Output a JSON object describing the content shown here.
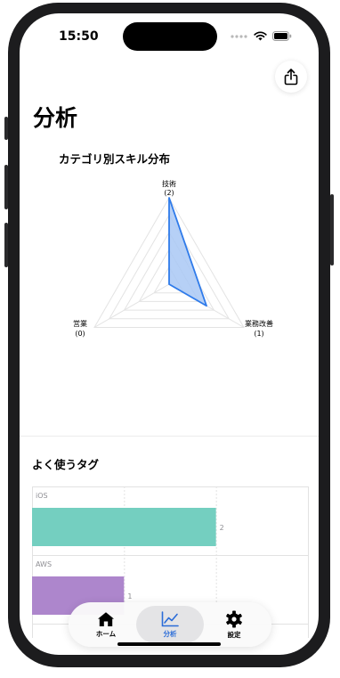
{
  "status_bar": {
    "time": "15:50"
  },
  "page": {
    "title": "分析"
  },
  "skill_chart": {
    "title": "カテゴリ別スキル分布",
    "axes": [
      {
        "label": "技術",
        "count": "(2)"
      },
      {
        "label": "業務改善",
        "count": "(1)"
      },
      {
        "label": "営業",
        "count": "(0)"
      }
    ]
  },
  "tags_section": {
    "title": "よく使うタグ"
  },
  "tabs": [
    {
      "label": "ホーム",
      "icon": "house-icon"
    },
    {
      "label": "分析",
      "icon": "chart-line-icon"
    },
    {
      "label": "設定",
      "icon": "gear-icon"
    }
  ],
  "colors": {
    "radar_fill": "#a9c8f5",
    "radar_stroke": "#2f7bea",
    "bar_ios": "#74cfc0",
    "bar_aws": "#ad86cc",
    "tab_active": "#2a6cd8"
  },
  "chart_data": [
    {
      "type": "radar",
      "title": "カテゴリ別スキル分布",
      "categories": [
        "技術",
        "業務改善",
        "営業"
      ],
      "values": [
        2,
        1,
        0
      ],
      "range": [
        0,
        2
      ]
    },
    {
      "type": "bar",
      "title": "よく使うタグ",
      "orientation": "horizontal",
      "categories": [
        "iOS",
        "AWS"
      ],
      "values": [
        2,
        1
      ],
      "xlim": [
        0,
        3
      ],
      "grid": true
    }
  ]
}
